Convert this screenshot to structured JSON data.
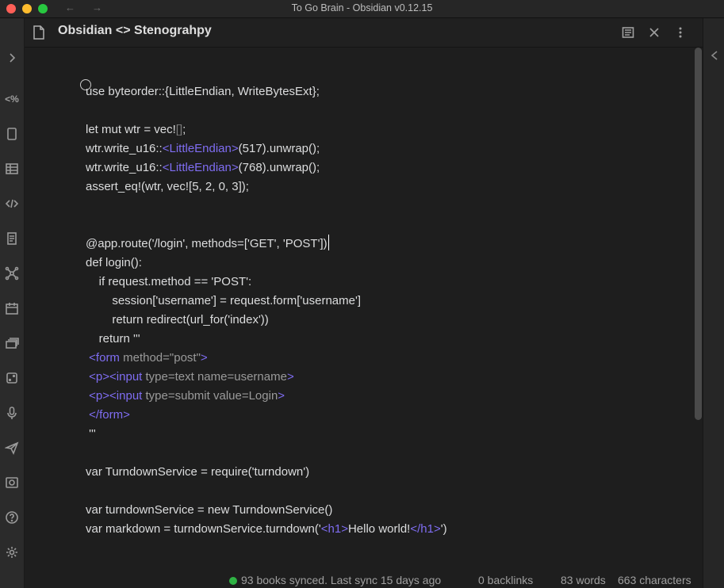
{
  "window": {
    "title": "To Go Brain - Obsidian v0.12.15"
  },
  "nav": {
    "back": "←",
    "forward": "→"
  },
  "view": {
    "title": "Obsidian <> Stenograhpy"
  },
  "editor": {
    "lines": [
      "use byteorder::{LittleEndian, WriteBytesExt};",
      "",
      "let mut wtr = vec![];",
      "wtr.write_u16::<LittleEndian>(517).unwrap();",
      "wtr.write_u16::<LittleEndian>(768).unwrap();",
      "assert_eq!(wtr, vec![5, 2, 0, 3]);",
      "",
      "",
      "@app.route('/login', methods=['GET', 'POST'])",
      "def login():",
      "    if request.method == 'POST':",
      "        session['username'] = request.form['username']",
      "        return redirect(url_for('index'))",
      "    return '''",
      " <form method=\"post\">",
      " <p><input type=text name=username>",
      " <p><input type=submit value=Login>",
      " </form>",
      " '''",
      "",
      "var TurndownService = require('turndown')",
      "",
      "var turndownService = new TurndownService()",
      "var markdown = turndownService.turndown('<h1>Hello world!</h1>')"
    ]
  },
  "status": {
    "sync": "93 books synced. Last sync 15 days ago",
    "backlinks": "0 backlinks",
    "words": "83 words",
    "characters": "663 characters"
  },
  "colors": {
    "accent": "#7f6df2",
    "sync_dot": "#2fb344"
  },
  "ribbon": {
    "icons": [
      "expand-icon",
      "percent-code-icon",
      "tablet-icon",
      "table-icon",
      "code-icon",
      "document-icon",
      "graph-icon",
      "calendar-icon",
      "cards-icon",
      "dice-icon",
      "microphone-icon",
      "send-icon",
      "vault-icon",
      "help-icon",
      "settings-icon"
    ]
  }
}
